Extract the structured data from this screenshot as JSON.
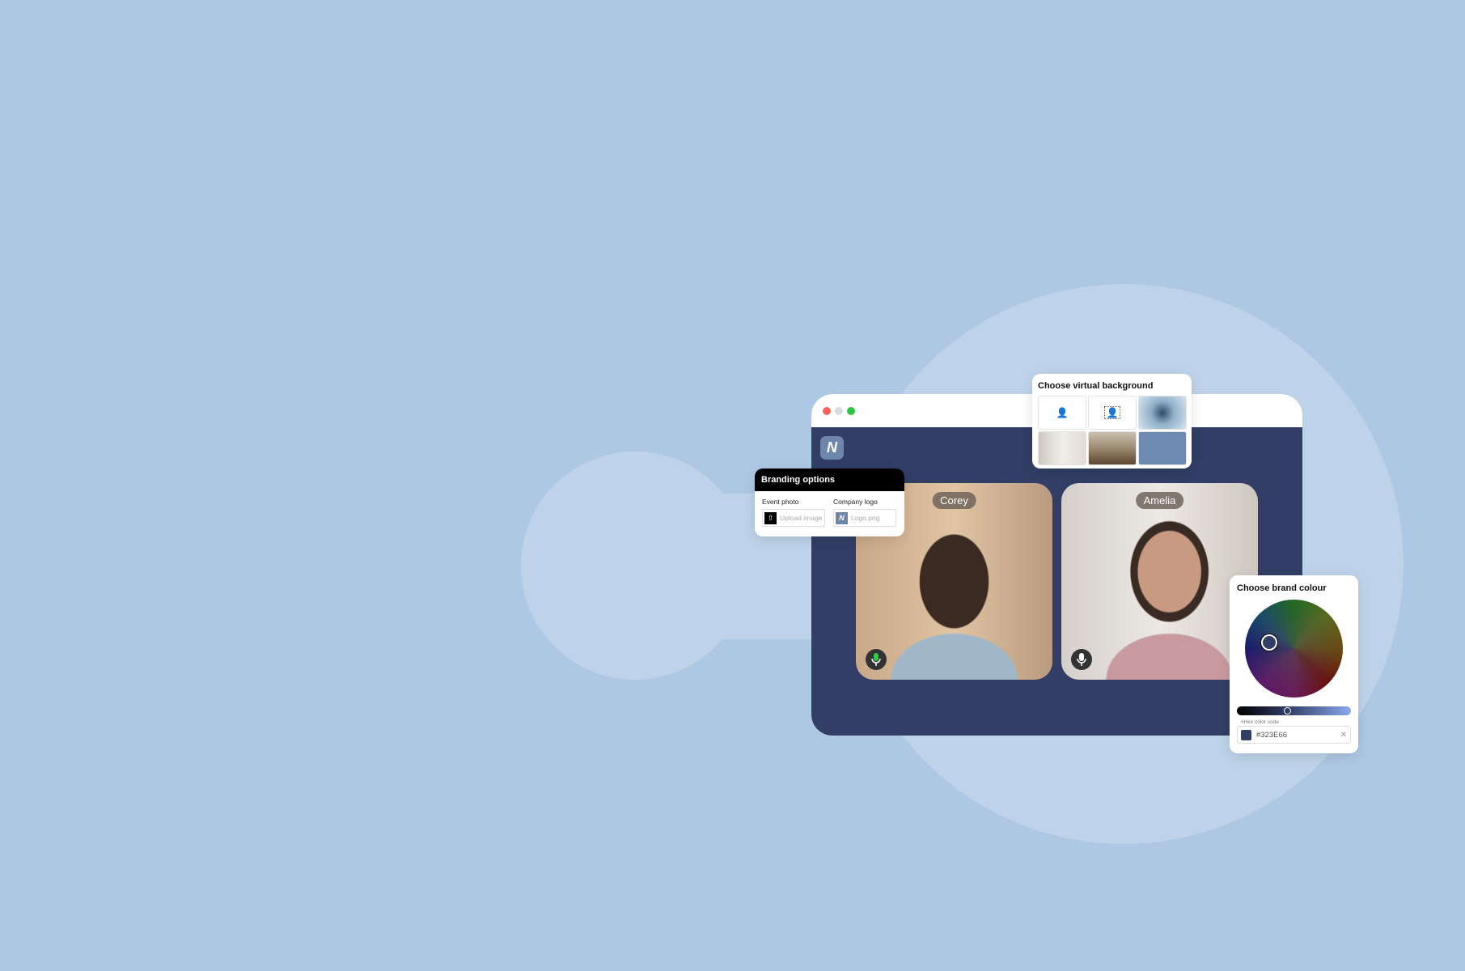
{
  "window": {
    "traffic_lights": [
      "#fe5f57",
      "#dcdcdc",
      "#28c840"
    ],
    "nav_color": "#323E66",
    "logo_icon": "brand-n-logo"
  },
  "participants": [
    {
      "name": "Corey",
      "mic": "active"
    },
    {
      "name": "Amelia",
      "mic": "idle"
    }
  ],
  "branding": {
    "title": "Branding options",
    "event_photo_label": "Event photo",
    "upload_placeholder": "Upload image",
    "company_logo_label": "Company logo",
    "logo_file": "Logo.png"
  },
  "virtual_background": {
    "title": "Choose virtual background",
    "options": [
      "none",
      "blur",
      "ice",
      "room",
      "desert",
      "solid-blue"
    ]
  },
  "brand_colour": {
    "title": "Choose brand colour",
    "hex_label": "#Hex color code",
    "hex_value": "#323E66",
    "brightness_percent": 41
  }
}
